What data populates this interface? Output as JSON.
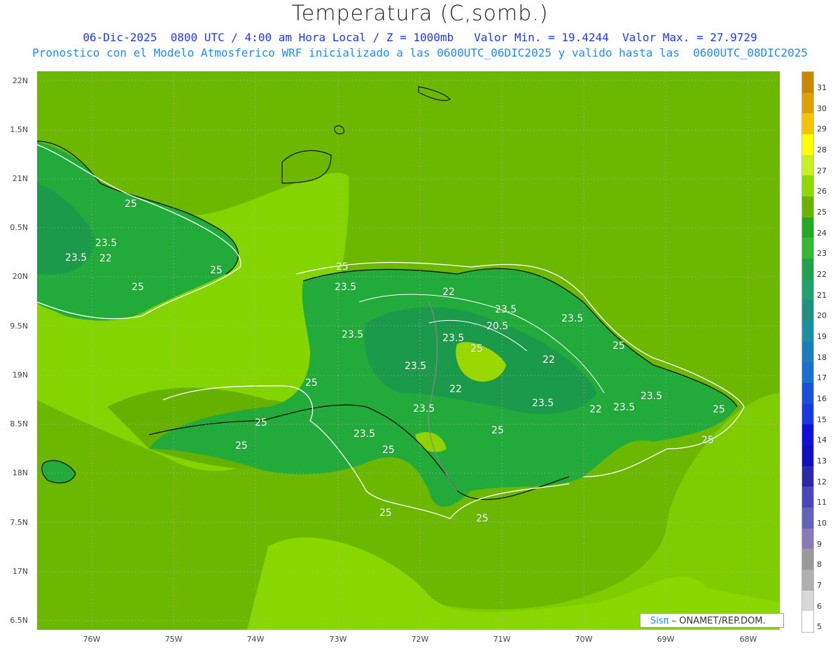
{
  "header": {
    "title": "Temperatura (C,somb.)",
    "line1": "06-Dic-2025  0800 UTC / 4:00 am Hora Local / Z = 1000mb   Valor Min. = 19.4244  Valor Max. = 27.9729",
    "line2": "Pronostico con el Modelo Atmosferico WRF inicializado a las 0600UTC_06DIC2025 y valido hasta las  0600UTC_08DIC2025"
  },
  "axes": {
    "y_labels": [
      "22N",
      "1.5N",
      "21N",
      "0.5N",
      "20N",
      "9.5N",
      "19N",
      "8.5N",
      "18N",
      "7.5N",
      "17N",
      "6.5N"
    ],
    "x_labels": [
      "76W",
      "75W",
      "74W",
      "73W",
      "72W",
      "71W",
      "70W",
      "69W",
      "68W"
    ]
  },
  "colorbar": {
    "labels": [
      "31",
      "30",
      "29",
      "28",
      "27",
      "26",
      "25",
      "24",
      "23",
      "22",
      "21",
      "20",
      "19",
      "18",
      "17",
      "16",
      "15",
      "14",
      "13",
      "12",
      "11",
      "10",
      "9",
      "8",
      "7",
      "6",
      "5"
    ],
    "colors": [
      "#c98800",
      "#e0a000",
      "#f5c400",
      "#ffff00",
      "#c8f020",
      "#8fd800",
      "#6ab400",
      "#22aa22",
      "#33b833",
      "#22a050",
      "#22a070",
      "#209080",
      "#1a8fa0",
      "#1a7fb8",
      "#1a6fd0",
      "#1a50d8",
      "#1a38e0",
      "#1010d8",
      "#1010c0",
      "#2a2aa8",
      "#4848b8",
      "#6262b8",
      "#8a78b8",
      "#9a9a9a",
      "#b0b0b0",
      "#d8d8d8",
      "#ffffff"
    ]
  },
  "contour_labels": [
    {
      "text": "25"
    },
    {
      "text": "23.5"
    },
    {
      "text": "23.5"
    },
    {
      "text": "22"
    },
    {
      "text": "25"
    },
    {
      "text": "25"
    },
    {
      "text": "25"
    },
    {
      "text": "23.5"
    },
    {
      "text": "22"
    },
    {
      "text": "23.5"
    },
    {
      "text": "23.5"
    },
    {
      "text": "20.5"
    },
    {
      "text": "23.5"
    },
    {
      "text": "23.5"
    },
    {
      "text": "25"
    },
    {
      "text": "25"
    },
    {
      "text": "23.5"
    },
    {
      "text": "25"
    },
    {
      "text": "22"
    },
    {
      "text": "22"
    },
    {
      "text": "25"
    },
    {
      "text": "23.5"
    },
    {
      "text": "23.5"
    },
    {
      "text": "22"
    },
    {
      "text": "23.5"
    },
    {
      "text": "23.5"
    },
    {
      "text": "25"
    },
    {
      "text": "25"
    },
    {
      "text": "23.5"
    },
    {
      "text": "25"
    },
    {
      "text": "25"
    },
    {
      "text": "25"
    },
    {
      "text": "25"
    },
    {
      "text": "25"
    }
  ],
  "credit": {
    "brand": "Sisπ",
    "text": " – ONAMET/REP.DOM."
  }
}
